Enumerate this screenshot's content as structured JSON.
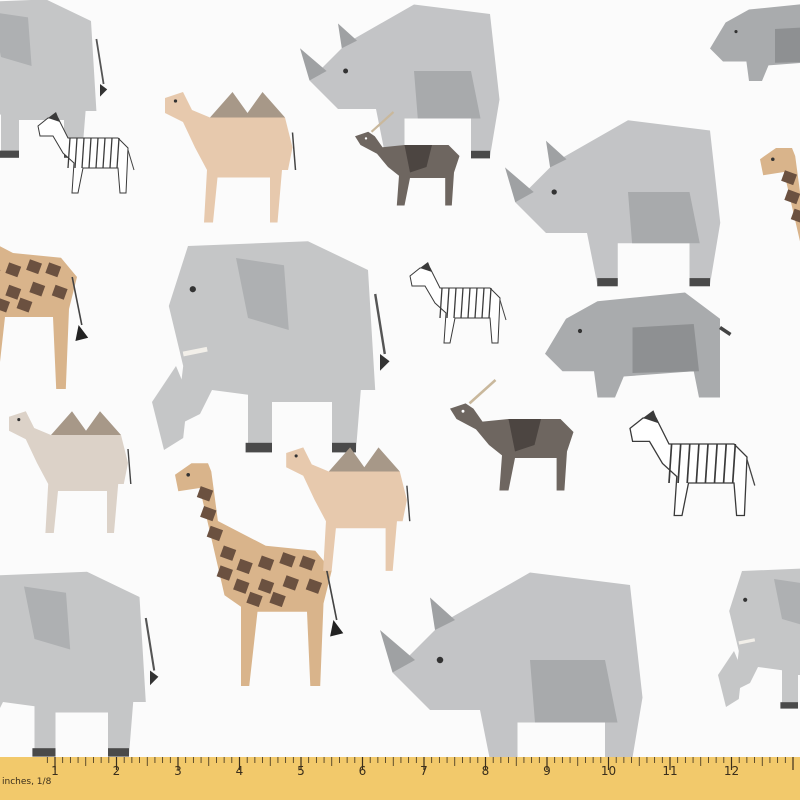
{
  "image": {
    "subject": "fabric-swatch",
    "pattern": "geometric-safari-animals",
    "background_color": "#fbfbfb"
  },
  "colors": {
    "elephant": "#c5c6c7",
    "elephant_shade": "#aeb0b2",
    "rhino": "#c3c4c6",
    "rhino_shade": "#a8aaac",
    "hippo": "#a9abad",
    "hippo_shade": "#8e9092",
    "camel": "#e7c9ad",
    "camel_hump": "#a79888",
    "camel_pale": "#dcd2c8",
    "giraffe_base": "#d9b48b",
    "giraffe_spot": "#6b5140",
    "antelope": "#6e6660",
    "antelope_shade": "#4c4541",
    "zebra": "#ffffff",
    "zebra_stripe": "#3a3a3a",
    "hoof": "#4a4a4a",
    "ruler": "#f2c96b",
    "ruler_text": "#3a2e1c"
  },
  "ruler": {
    "unit_label": "inches, 1/8",
    "numbers": [
      "1",
      "2",
      "3",
      "4",
      "5",
      "6",
      "7",
      "8",
      "9",
      "10",
      "11",
      "12"
    ]
  }
}
